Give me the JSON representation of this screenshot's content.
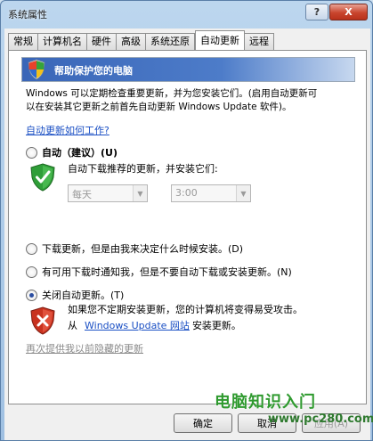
{
  "window": {
    "title": "系统属性",
    "help_label": "?",
    "close_label": "X"
  },
  "tabs": [
    {
      "label": "常规"
    },
    {
      "label": "计算机名"
    },
    {
      "label": "硬件"
    },
    {
      "label": "高级"
    },
    {
      "label": "系统还原"
    },
    {
      "label": "自动更新"
    },
    {
      "label": "远程"
    }
  ],
  "active_tab": "自动更新",
  "banner": {
    "text": "帮助保护您的电脑"
  },
  "description": {
    "line1": "Windows 可以定期检查重要更新，并为您安装它们。(启用自动更新可",
    "line2": "以在安装其它更新之前首先自动更新 Windows Update 软件)。"
  },
  "how_link": "自动更新如何工作?",
  "options": {
    "auto": {
      "label": "自动（建议）(U)",
      "selected": false,
      "sub": "自动下载推荐的更新，并安装它们:"
    },
    "download": {
      "label": "下载更新，但是由我来决定什么时候安装。(D)",
      "selected": false
    },
    "notify": {
      "label": "有可用下载时通知我，但是不要自动下载或安装更新。(N)",
      "selected": false
    },
    "off": {
      "label": "关闭自动更新。(T)",
      "selected": true,
      "sub1": "如果您不定期安装更新，您的计算机将变得易受攻击。",
      "sub2_prefix": "从",
      "sub2_link": "Windows Update 网站",
      "sub2_suffix": "安装更新。"
    }
  },
  "schedule": {
    "day_value": "每天",
    "time_value": "3:00"
  },
  "hidden_updates_link": "再次提供我以前隐藏的更新",
  "buttons": {
    "ok": "确定",
    "cancel": "取消",
    "apply": "应用(A)"
  },
  "watermark": {
    "text": "电脑知识入门",
    "url": "www.pc280.com"
  },
  "colors": {
    "accent": "#3a66b8",
    "link": "#1a4fc4",
    "watermark": "#2f9a2f"
  }
}
